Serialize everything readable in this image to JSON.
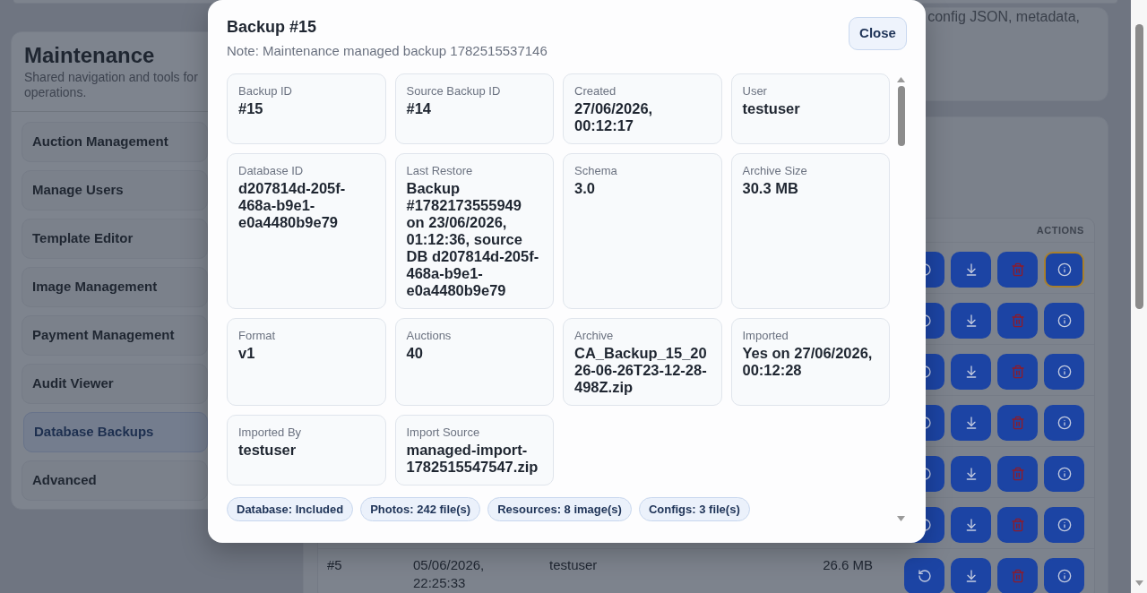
{
  "sidebar": {
    "title": "Maintenance",
    "subtitle": "Shared navigation and tools for operations.",
    "items": [
      {
        "label": "Auction Management",
        "selected": false
      },
      {
        "label": "Manage Users",
        "selected": false
      },
      {
        "label": "Template Editor",
        "selected": false
      },
      {
        "label": "Image Management",
        "selected": false
      },
      {
        "label": "Payment Management",
        "selected": false
      },
      {
        "label": "Audit Viewer",
        "selected": false
      },
      {
        "label": "Database Backups",
        "selected": true
      },
      {
        "label": "Advanced",
        "selected": false
      }
    ]
  },
  "description": {
    "text": "config JSON, metadata,"
  },
  "backups_table": {
    "actions_header": "ACTIONS",
    "rows": [
      {
        "actions": [
          {
            "kind": "restore",
            "focused": false
          },
          {
            "kind": "download",
            "focused": false
          },
          {
            "kind": "delete",
            "focused": false
          },
          {
            "kind": "info",
            "focused": true
          }
        ]
      },
      {
        "actions": [
          {
            "kind": "restore",
            "focused": false
          },
          {
            "kind": "download",
            "focused": false
          },
          {
            "kind": "delete",
            "focused": false
          },
          {
            "kind": "info",
            "focused": false
          }
        ]
      },
      {
        "actions": [
          {
            "kind": "restore",
            "focused": false
          },
          {
            "kind": "download",
            "focused": false
          },
          {
            "kind": "delete",
            "focused": false
          },
          {
            "kind": "info",
            "focused": false
          }
        ]
      },
      {
        "actions": [
          {
            "kind": "restore",
            "focused": false
          },
          {
            "kind": "download",
            "focused": false
          },
          {
            "kind": "delete",
            "focused": false
          },
          {
            "kind": "info",
            "focused": false
          }
        ]
      },
      {
        "actions": [
          {
            "kind": "restore",
            "focused": false
          },
          {
            "kind": "download",
            "focused": false
          },
          {
            "kind": "delete",
            "focused": false
          },
          {
            "kind": "info",
            "focused": false
          }
        ]
      },
      {
        "actions": [
          {
            "kind": "restore",
            "focused": false
          },
          {
            "kind": "download",
            "focused": false
          },
          {
            "kind": "delete",
            "focused": false
          },
          {
            "kind": "info",
            "focused": false
          }
        ]
      },
      {
        "id": "#5",
        "created": "05/06/2026, 22:25:33",
        "user": "testuser",
        "size": "26.6 MB",
        "actions": [
          {
            "kind": "restore",
            "focused": false
          },
          {
            "kind": "download",
            "focused": false
          },
          {
            "kind": "delete",
            "focused": false
          },
          {
            "kind": "info",
            "focused": false
          }
        ]
      }
    ]
  },
  "dialog": {
    "title": "Backup #15",
    "note": "Note: Maintenance managed backup 1782515537146",
    "close_button": "Close",
    "fields": [
      {
        "label": "Backup ID",
        "value": "#15"
      },
      {
        "label": "Source Backup ID",
        "value": "#14"
      },
      {
        "label": "Created",
        "value": "27/06/2026, 00:12:17"
      },
      {
        "label": "User",
        "value": "testuser"
      },
      {
        "label": "Database ID",
        "value": "d207814d-205f-468a-b9e1-e0a4480b9e79"
      },
      {
        "label": "Last Restore",
        "value": "Backup #1782173555949 on 23/06/2026, 01:12:36, source DB d207814d-205f-468a-b9e1-e0a4480b9e79"
      },
      {
        "label": "Schema",
        "value": "3.0"
      },
      {
        "label": "Archive Size",
        "value": "30.3 MB"
      },
      {
        "label": "Format",
        "value": "v1"
      },
      {
        "label": "Auctions",
        "value": "40"
      },
      {
        "label": "Archive",
        "value": "CA_Backup_15_2026-06-26T23-12-28-498Z.zip"
      },
      {
        "label": "Imported",
        "value": "Yes on 27/06/2026, 00:12:28"
      },
      {
        "label": "Imported By",
        "value": "testuser"
      },
      {
        "label": "Import Source",
        "value": "managed-import-1782515547547.zip"
      }
    ],
    "badges": [
      "Database: Included",
      "Photos: 242 file(s)",
      "Resources: 8 image(s)",
      "Configs: 3 file(s)"
    ]
  }
}
